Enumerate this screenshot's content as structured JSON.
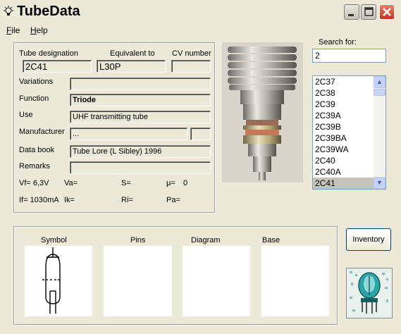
{
  "app": {
    "title": "TubeData"
  },
  "menu": {
    "file": "File",
    "help": "Help"
  },
  "fields": {
    "tube_designation_label": "Tube designation",
    "tube_designation_value": "2C41",
    "equivalent_label": "Equivalent to",
    "equivalent_value": "L30P",
    "cv_label": "CV number",
    "cv_value": "",
    "variations_label": "Variations",
    "variations_value": "",
    "function_label": "Function",
    "function_value": "Triode",
    "use_label": "Use",
    "use_value": "UHF transmitting tube",
    "manufacturer_label": "Manufacturer",
    "manufacturer_value": "...",
    "manufacturer_extra": "",
    "databook_label": "Data book",
    "databook_value": "Tube Lore (L Sibley) 1996",
    "remarks_label": "Remarks",
    "remarks_value": ""
  },
  "params": {
    "vf": "Vf= 6,3V",
    "va": "Va=",
    "s": "S=",
    "mu": "μ=",
    "mu_value": "0",
    "if": "If= 1030mA",
    "ik": "Ik=",
    "ri": "Ri=",
    "pa": "Pa="
  },
  "search": {
    "label": "Search for:",
    "value": "2",
    "items": [
      "2C37",
      "2C38",
      "2C39",
      "2C39A",
      "2C39B",
      "2C39BA",
      "2C39WA",
      "2C40",
      "2C40A",
      "2C41"
    ],
    "selected": "2C41"
  },
  "sections": {
    "symbol": "Symbol",
    "pins": "Pins",
    "diagram": "Diagram",
    "base": "Base"
  },
  "buttons": {
    "inventory": "Inventory"
  },
  "icons": [
    "bulb-icon",
    "minimize-icon",
    "maximize-icon",
    "close-icon",
    "scroll-up-icon",
    "scroll-down-icon",
    "triode-symbol-icon",
    "tube-logo-icon"
  ]
}
